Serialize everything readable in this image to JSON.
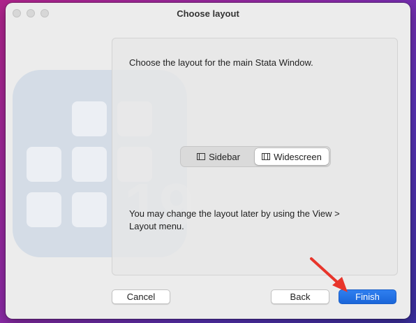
{
  "window": {
    "title": "Choose layout"
  },
  "panel": {
    "intro_text": "Choose the layout for the main Stata Window.",
    "note_text": "You may change the layout later by using the View > Layout menu."
  },
  "layout_options": [
    {
      "label": "Sidebar",
      "icon": "sidebar-layout-icon",
      "selected": false
    },
    {
      "label": "Widescreen",
      "icon": "widescreen-layout-icon",
      "selected": true
    }
  ],
  "watermark": {
    "number": "19"
  },
  "buttons": {
    "cancel": "Cancel",
    "back": "Back",
    "finish": "Finish"
  },
  "colors": {
    "accent": "#1a66d9",
    "arrow": "#e8352b"
  }
}
